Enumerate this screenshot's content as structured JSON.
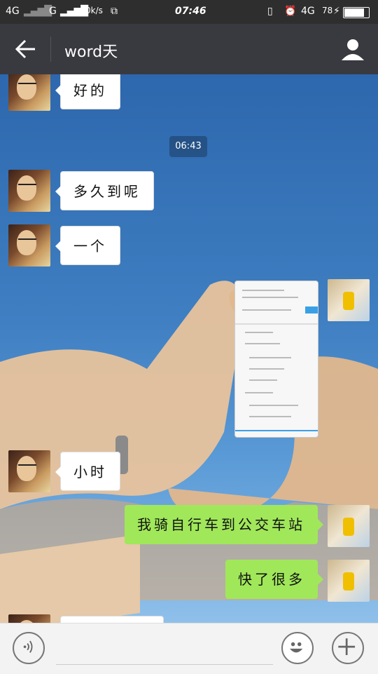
{
  "status": {
    "left": "4G",
    "net": "G",
    "speed": "0k/s",
    "time": "07:46",
    "right_net": "4G",
    "battery": "78"
  },
  "header": {
    "title": "word天"
  },
  "chat": {
    "timestamp": "06:43",
    "messages": [
      {
        "text": "好的",
        "side": "left"
      },
      {
        "text": "多久到呢",
        "side": "left"
      },
      {
        "text": "一个",
        "side": "left"
      },
      {
        "type": "image",
        "side": "right"
      },
      {
        "text": "小时",
        "side": "left"
      },
      {
        "text": "我骑自行车到公交车站",
        "side": "right"
      },
      {
        "text": "快了很多",
        "side": "right"
      },
      {
        "text": "",
        "side": "left"
      }
    ]
  },
  "colors": {
    "outgoing": "#a0e75a",
    "header": "#393a3f"
  }
}
